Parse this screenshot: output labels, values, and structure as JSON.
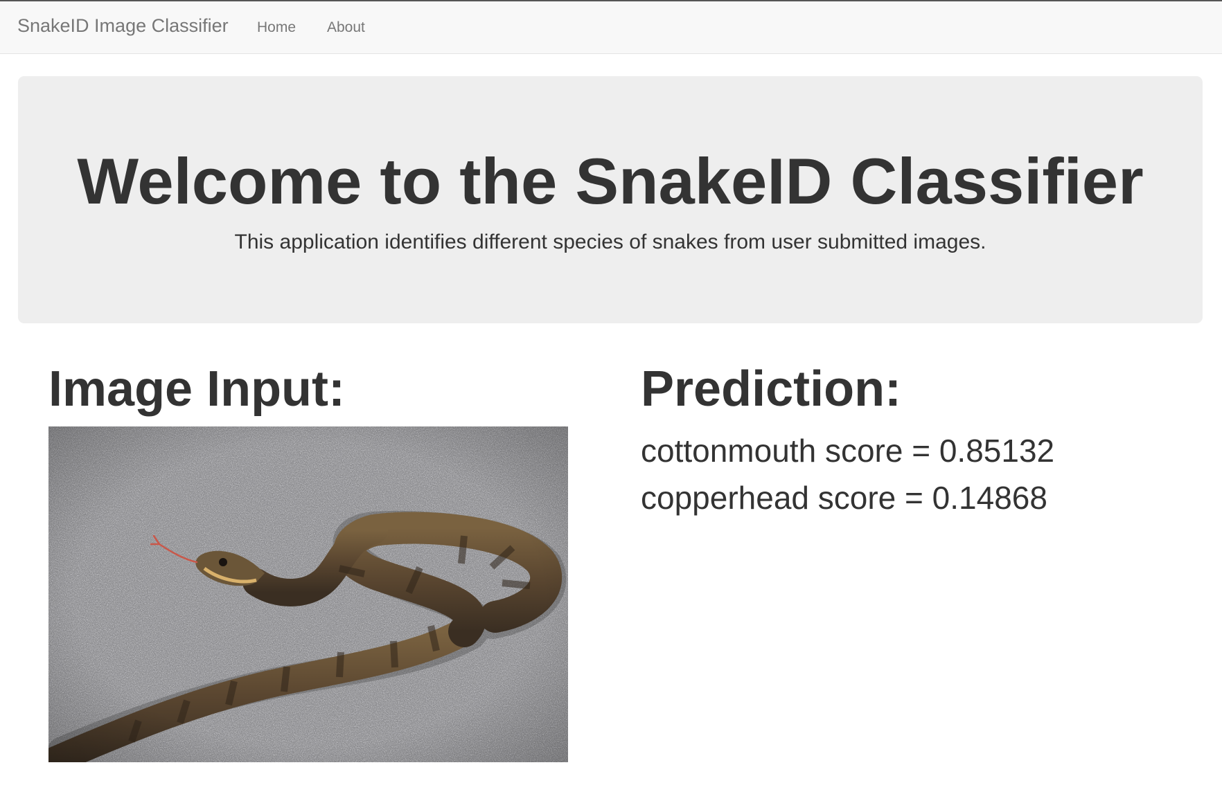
{
  "navbar": {
    "brand": "SnakeID Image Classifier",
    "links": [
      {
        "label": "Home"
      },
      {
        "label": "About"
      }
    ]
  },
  "jumbotron": {
    "title": "Welcome to the SnakeID Classifier",
    "subtitle": "This application identifies different species of snakes from user submitted images."
  },
  "input_section": {
    "title": "Image Input:",
    "image_subject": "snake-on-asphalt-photo"
  },
  "prediction_section": {
    "title": "Prediction:",
    "scores": [
      {
        "text": "cottonmouth score = 0.85132"
      },
      {
        "text": "copperhead score = 0.14868"
      }
    ]
  },
  "colors": {
    "navbar_bg": "#f8f8f8",
    "jumbotron_bg": "#eeeeee",
    "text": "#333333",
    "muted": "#777777"
  }
}
